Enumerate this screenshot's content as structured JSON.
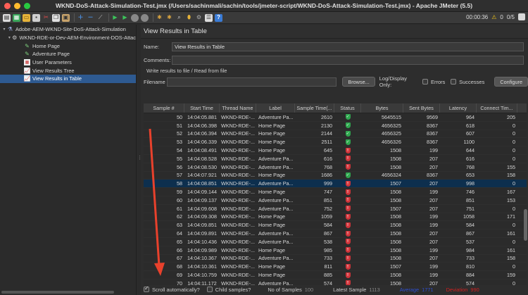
{
  "window": {
    "title": "WKND-DoS-Attack-Simulation-Test.jmx (/Users/sachinmali/sachin/tools/jmeter-script/WKND-DoS-Attack-Simulation-Test.jmx) - Apache JMeter (5.5)"
  },
  "toolbar": {
    "elapsed": "00:00:36",
    "warning_count": "0",
    "threads": "0/5"
  },
  "tree": {
    "items": [
      {
        "label": "Adobe-AEM-WKND-Site-DoS-Attack-Simulation",
        "icon": "test-plan-icon",
        "level": 0
      },
      {
        "label": "WKND-RDE-or-Dev-AEM-Environment-DOS-Attac",
        "icon": "gear-icon",
        "level": 1
      },
      {
        "label": "Home Page",
        "icon": "sampler-icon",
        "level": 2
      },
      {
        "label": "Adventure Page",
        "icon": "sampler-icon",
        "level": 2
      },
      {
        "label": "User Parameters",
        "icon": "parameters-icon",
        "level": 2
      },
      {
        "label": "View Results Tree",
        "icon": "listener-icon",
        "level": 2
      },
      {
        "label": "View Results in Table",
        "icon": "listener-icon",
        "level": 2,
        "selected": true
      }
    ]
  },
  "panel": {
    "title": "View Results in Table",
    "name_label": "Name:",
    "name_value": "View Results in Table",
    "comments_label": "Comments:",
    "comments_value": "",
    "file_group_label": "Write results to file / Read from file",
    "filename_label": "Filename",
    "filename_value": "",
    "browse_label": "Browse...",
    "log_display_label": "Log/Display Only:",
    "errors_label": "Errors",
    "successes_label": "Successes",
    "configure_label": "Configure"
  },
  "table": {
    "columns": [
      "Sample #",
      "Start Time",
      "Thread Name",
      "Label",
      "Sample Time(...",
      "Status",
      "Bytes",
      "Sent Bytes",
      "Latency",
      "Connect Tim..."
    ],
    "rows": [
      {
        "n": "50",
        "t": "14:04:05.881",
        "th": "WKND-RDE-...",
        "l": "Adventure Pa...",
        "st": "2610",
        "ok": true,
        "b": "5645515",
        "sb": "9569",
        "lat": "964",
        "ct": "205"
      },
      {
        "n": "51",
        "t": "14:04:06.398",
        "th": "WKND-RDE-...",
        "l": "Home Page",
        "st": "2130",
        "ok": true,
        "b": "4656325",
        "sb": "8367",
        "lat": "618",
        "ct": "0"
      },
      {
        "n": "52",
        "t": "14:04:06.394",
        "th": "WKND-RDE-...",
        "l": "Home Page",
        "st": "2144",
        "ok": true,
        "b": "4656325",
        "sb": "8367",
        "lat": "607",
        "ct": "0"
      },
      {
        "n": "53",
        "t": "14:04:06.339",
        "th": "WKND-RDE-...",
        "l": "Home Page",
        "st": "2511",
        "ok": true,
        "b": "4656326",
        "sb": "8367",
        "lat": "1100",
        "ct": "0"
      },
      {
        "n": "54",
        "t": "14:04:08.491",
        "th": "WKND-RDE-...",
        "l": "Home Page",
        "st": "645",
        "ok": false,
        "b": "1508",
        "sb": "199",
        "lat": "644",
        "ct": "0"
      },
      {
        "n": "55",
        "t": "14:04:08.528",
        "th": "WKND-RDE-...",
        "l": "Adventure Pa...",
        "st": "616",
        "ok": false,
        "b": "1508",
        "sb": "207",
        "lat": "616",
        "ct": "0"
      },
      {
        "n": "56",
        "t": "14:04:08.530",
        "th": "WKND-RDE-...",
        "l": "Adventure Pa...",
        "st": "768",
        "ok": false,
        "b": "1508",
        "sb": "207",
        "lat": "768",
        "ct": "155"
      },
      {
        "n": "57",
        "t": "14:04:07.921",
        "th": "WKND-RDE-...",
        "l": "Home Page",
        "st": "1686",
        "ok": true,
        "b": "4656324",
        "sb": "8367",
        "lat": "653",
        "ct": "158"
      },
      {
        "n": "58",
        "t": "14:04:08.851",
        "th": "WKND-RDE-...",
        "l": "Adventure Pa...",
        "st": "999",
        "ok": false,
        "b": "1507",
        "sb": "207",
        "lat": "998",
        "ct": "0",
        "selected": true
      },
      {
        "n": "59",
        "t": "14:04:09.144",
        "th": "WKND-RDE-...",
        "l": "Home Page",
        "st": "747",
        "ok": false,
        "b": "1508",
        "sb": "199",
        "lat": "746",
        "ct": "167"
      },
      {
        "n": "60",
        "t": "14:04:09.137",
        "th": "WKND-RDE-...",
        "l": "Adventure Pa...",
        "st": "851",
        "ok": false,
        "b": "1508",
        "sb": "207",
        "lat": "851",
        "ct": "153"
      },
      {
        "n": "61",
        "t": "14:04:09.608",
        "th": "WKND-RDE-...",
        "l": "Adventure Pa...",
        "st": "752",
        "ok": false,
        "b": "1507",
        "sb": "207",
        "lat": "751",
        "ct": "0"
      },
      {
        "n": "62",
        "t": "14:04:09.308",
        "th": "WKND-RDE-...",
        "l": "Home Page",
        "st": "1059",
        "ok": false,
        "b": "1508",
        "sb": "199",
        "lat": "1058",
        "ct": "171"
      },
      {
        "n": "63",
        "t": "14:04:09.851",
        "th": "WKND-RDE-...",
        "l": "Home Page",
        "st": "584",
        "ok": false,
        "b": "1508",
        "sb": "199",
        "lat": "584",
        "ct": "0"
      },
      {
        "n": "64",
        "t": "14:04:09.891",
        "th": "WKND-RDE-...",
        "l": "Adventure Pa...",
        "st": "867",
        "ok": false,
        "b": "1508",
        "sb": "207",
        "lat": "867",
        "ct": "161"
      },
      {
        "n": "65",
        "t": "14:04:10.436",
        "th": "WKND-RDE-...",
        "l": "Adventure Pa...",
        "st": "538",
        "ok": false,
        "b": "1508",
        "sb": "207",
        "lat": "537",
        "ct": "0"
      },
      {
        "n": "66",
        "t": "14:04:09.989",
        "th": "WKND-RDE-...",
        "l": "Home Page",
        "st": "985",
        "ok": false,
        "b": "1508",
        "sb": "199",
        "lat": "984",
        "ct": "161"
      },
      {
        "n": "67",
        "t": "14:04:10.367",
        "th": "WKND-RDE-...",
        "l": "Adventure Pa...",
        "st": "733",
        "ok": false,
        "b": "1508",
        "sb": "207",
        "lat": "733",
        "ct": "158"
      },
      {
        "n": "68",
        "t": "14:04:10.361",
        "th": "WKND-RDE-...",
        "l": "Home Page",
        "st": "811",
        "ok": false,
        "b": "1507",
        "sb": "199",
        "lat": "810",
        "ct": "0"
      },
      {
        "n": "69",
        "t": "14:04:10.759",
        "th": "WKND-RDE-...",
        "l": "Home Page",
        "st": "885",
        "ok": false,
        "b": "1508",
        "sb": "199",
        "lat": "884",
        "ct": "159"
      },
      {
        "n": "70",
        "t": "14:04:11.172",
        "th": "WKND-RDE-...",
        "l": "Adventure Pa...",
        "st": "574",
        "ok": false,
        "b": "1508",
        "sb": "207",
        "lat": "574",
        "ct": "0"
      }
    ]
  },
  "footer": {
    "scroll_label": "Scroll automatically?",
    "child_label": "Child samples?",
    "samples_label": "No of Samples",
    "samples_value": "100",
    "latest_label": "Latest Sample",
    "latest_value": "1113",
    "average_label": "Average",
    "average_value": "1771",
    "deviation_label": "Deviation",
    "deviation_value": "990"
  },
  "colors": {
    "selection_tree": "#2e5a91",
    "selection_row": "#0d2f4e",
    "success": "#2fa84f",
    "error": "#d0343a",
    "arrow": "#e8412c",
    "average": "#2e4fd0",
    "deviation": "#d02020"
  }
}
